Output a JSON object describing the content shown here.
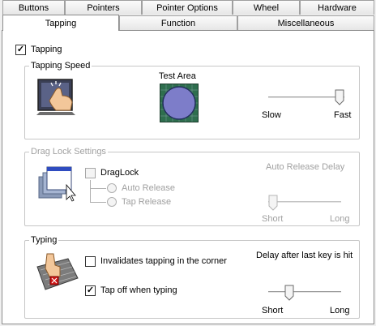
{
  "tabs_row1": [
    {
      "label": "Buttons"
    },
    {
      "label": "Pointers"
    },
    {
      "label": "Pointer Options"
    },
    {
      "label": "Wheel"
    },
    {
      "label": "Hardware"
    }
  ],
  "tabs_row2": [
    {
      "label": "Tapping",
      "active": true
    },
    {
      "label": "Function"
    },
    {
      "label": "Miscellaneous"
    }
  ],
  "tapping": {
    "label": "Tapping",
    "checked": true
  },
  "tapping_speed": {
    "title": "Tapping Speed",
    "test_area": "Test Area",
    "slow": "Slow",
    "fast": "Fast",
    "value": 1.0
  },
  "drag_lock": {
    "title": "Drag Lock Settings",
    "draglock_label": "DragLock",
    "draglock_checked": false,
    "auto_release": "Auto Release",
    "tap_release": "Tap Release",
    "auto_release_delay": "Auto Release Delay",
    "short": "Short",
    "long": "Long",
    "value": 0.0
  },
  "typing": {
    "title": "Typing",
    "invalidate_label": "Invalidates tapping in the corner",
    "invalidate_checked": false,
    "tapoff_label": "Tap off when typing",
    "tapoff_checked": true,
    "delay_label": "Delay after last key is hit",
    "short": "Short",
    "long": "Long",
    "value": 0.25
  },
  "check_glyph": "✓",
  "colors": {
    "test_area_bg": "#2e6e4e",
    "test_area_circle": "#7d7dc9",
    "border": "#8b8b8b"
  }
}
